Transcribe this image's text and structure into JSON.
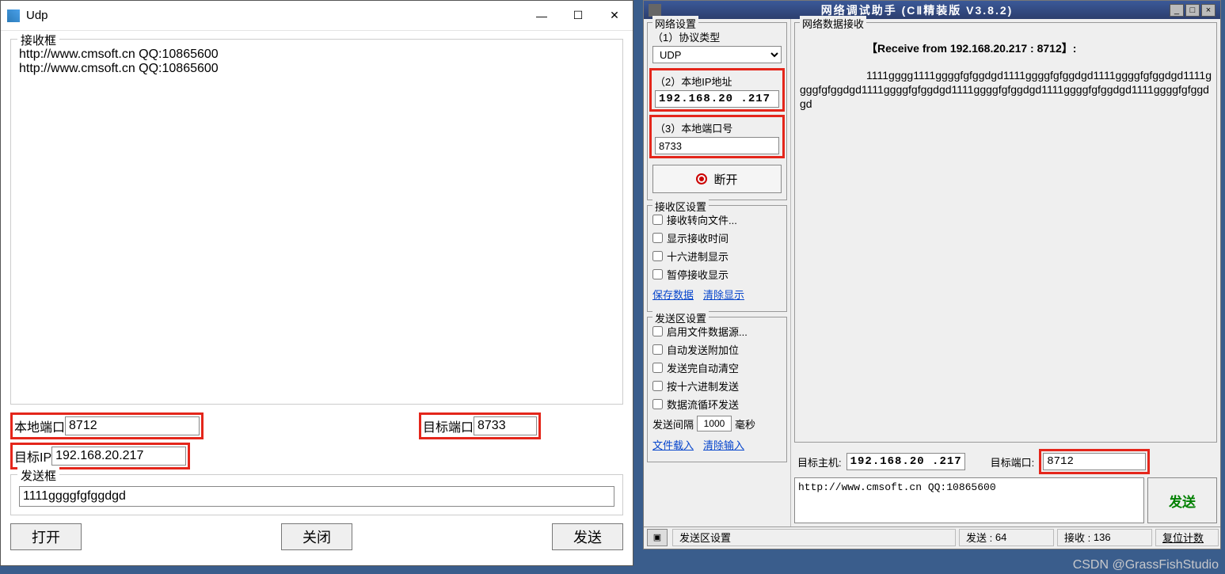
{
  "left": {
    "title": "Udp",
    "recv_label": "接收框",
    "recv_content": "http://www.cmsoft.cn QQ:10865600\nhttp://www.cmsoft.cn QQ:10865600",
    "local_port_label": "本地端口",
    "local_port_value": "8712",
    "target_port_label": "目标端口",
    "target_port_value": "8733",
    "target_ip_label": "目标IP",
    "target_ip_value": "192.168.20.217",
    "send_label": "发送框",
    "send_value": "1111ggggfgfggdgd",
    "btn_open": "打开",
    "btn_close": "关闭",
    "btn_send": "发送"
  },
  "right": {
    "title": "网络调试助手  (CⅡ精装版  V3.8.2)",
    "net_settings": {
      "label": "网络设置",
      "protocol_label": "（1）协议类型",
      "protocol_value": "UDP",
      "ip_label": "（2）本地IP地址",
      "ip_value": "192.168.20 .217",
      "port_label": "（3）本地端口号",
      "port_value": "8733",
      "disconnect": "断开"
    },
    "recv_settings": {
      "label": "接收区设置",
      "opt1": "接收转向文件...",
      "opt2": "显示接收时间",
      "opt3": "十六进制显示",
      "opt4": "暂停接收显示",
      "link1": "保存数据",
      "link2": "清除显示"
    },
    "send_settings": {
      "label": "发送区设置",
      "opt1": "启用文件数据源...",
      "opt2": "自动发送附加位",
      "opt3": "发送完自动清空",
      "opt4": "按十六进制发送",
      "opt5": "数据流循环发送",
      "interval_label": "发送间隔",
      "interval_value": "1000",
      "interval_unit": "毫秒",
      "link1": "文件载入",
      "link2": "清除输入"
    },
    "recv_area": {
      "label": "网络数据接收",
      "header": "【Receive from 192.168.20.217 : 8712】:",
      "content": "1111gggg1111ggggfgfggdgd1111ggggfgfggdgd1111ggggfgfggdgd1111ggggfgfggdgd1111ggggfgfggdgd1111ggggfgfggdgd1111ggggfgfggdgd1111ggggfgfggdgd"
    },
    "target": {
      "host_label": "目标主机:",
      "host_value": "192.168.20 .217",
      "port_label": "目标端口:",
      "port_value": "8712"
    },
    "send_text": "http://www.cmsoft.cn QQ:10865600",
    "send_btn": "发送",
    "status": {
      "send_area_label": "发送区设置",
      "send_count_label": "发送 :",
      "send_count": "64",
      "recv_count_label": "接收 :",
      "recv_count": "136",
      "reset": "复位计数"
    }
  },
  "watermark": "CSDN @GrassFishStudio"
}
